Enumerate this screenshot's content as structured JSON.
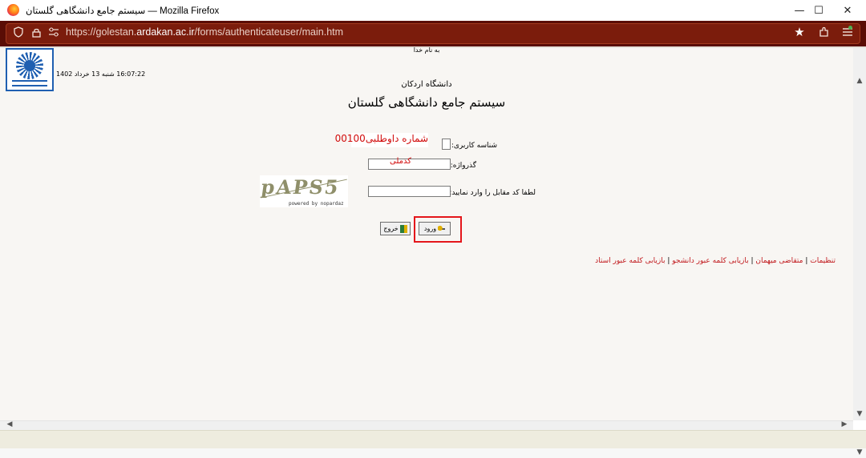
{
  "window": {
    "title": "سیستم جامع دانشگاهی گلستان — Mozilla Firefox",
    "min_glyph": "—",
    "max_glyph": "☐",
    "close_glyph": "✕"
  },
  "browser": {
    "url_prefix": "https://golestan.",
    "url_host": "ardakan.ac.ir",
    "url_path": "/forms/authenticateuser/main.htm",
    "icons": [
      "shield-icon",
      "lock-icon",
      "permissions-icon",
      "bookmark-star-icon",
      "extensions-icon",
      "menu-icon"
    ]
  },
  "page": {
    "besm": "به نام خدا",
    "datetime": "16:07:22 شنبه 13 خرداد 1402",
    "university": "دانشگاه اردکان",
    "system_title": "سیستم جامع دانشگاهی گلستان",
    "form": {
      "username_label": "شناسه کاربری:",
      "username_value": "",
      "username_hint": "شماره داوطلبی00100",
      "password_label": "گذرواژه:",
      "password_value": "",
      "password_hint": "کدملی",
      "captcha_label": "لطفا کد مقابل را وارد نمایید:",
      "captcha_value": "",
      "captcha_text": "pAPS5",
      "captcha_caption": "powered by nopardaz"
    },
    "buttons": {
      "login": "ورود",
      "exit": "خروج"
    },
    "links": [
      {
        "label": "تنظیمات"
      },
      {
        "label": "متقاضی میهمان"
      },
      {
        "label": "بازیابی کلمه عبور دانشجو"
      },
      {
        "label": "بازیابی کلمه عبور استاد"
      }
    ],
    "link_separator": "|"
  },
  "colors": {
    "toolbar": "#5a0d05",
    "accent_red": "#d10a0a",
    "link_red": "#c0171b",
    "highlight": "#e4161b",
    "logo_blue": "#1f5fb1"
  }
}
